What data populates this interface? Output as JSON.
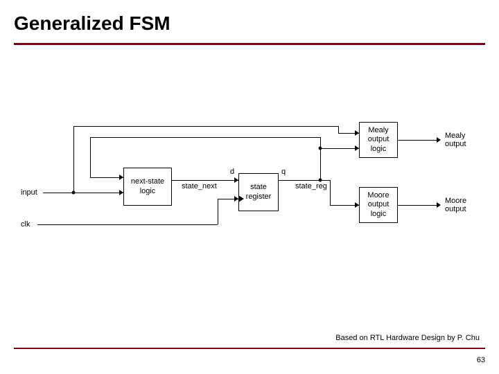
{
  "title": "Generalized FSM",
  "footer": "Based on RTL Hardware Design by P. Chu",
  "page": "63",
  "diagram": {
    "labels": {
      "input": "input",
      "clk": "clk",
      "state_next": "state_next",
      "d": "d",
      "q": "q",
      "state_reg": "state_reg",
      "mealy_out": "Mealy\noutput",
      "moore_out": "Moore\noutput"
    },
    "blocks": {
      "next_state": "next-state\nlogic",
      "state_register": "state\nregister",
      "mealy_logic": "Mealy\noutput\nlogic",
      "moore_logic": "Moore\noutput\nlogic"
    }
  }
}
